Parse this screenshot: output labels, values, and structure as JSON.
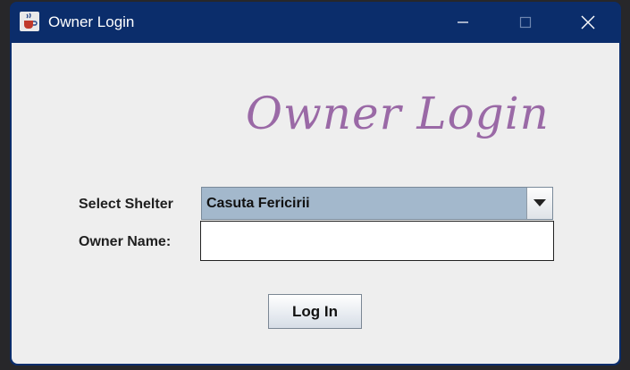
{
  "window": {
    "title": "Owner Login"
  },
  "form": {
    "heading": "Owner Login",
    "shelter_label": "Select Shelter",
    "shelter_selected": "Casuta Fericirii",
    "owner_name_label": "Owner Name:",
    "owner_name_value": "",
    "login_button": "Log In"
  },
  "icons": {
    "app": "java-coffee-cup-icon",
    "minimize": "minimize-icon",
    "maximize": "maximize-icon",
    "close": "close-icon",
    "dropdown": "triangle-down-icon"
  },
  "colors": {
    "titlebar": "#0b2d6b",
    "content_bg": "#eeeeee",
    "heading": "#9a69a6",
    "combo_bg": "#a3b8cc"
  }
}
